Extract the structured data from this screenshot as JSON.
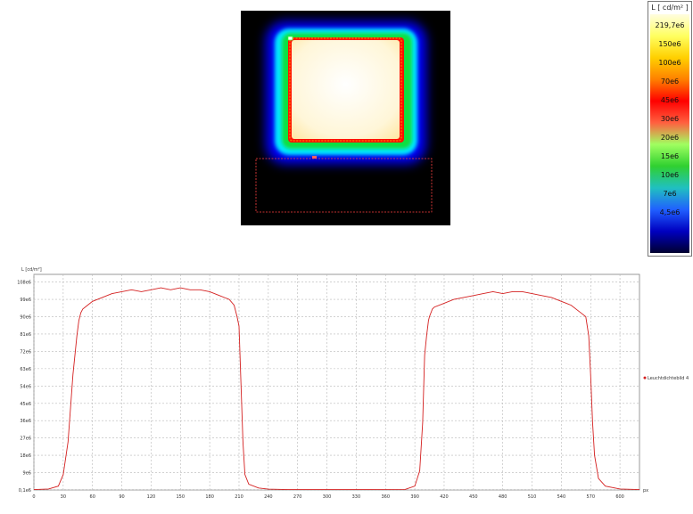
{
  "colorbar": {
    "title": "L [ cd/m² ]",
    "ticks": [
      {
        "label": "219,7e6",
        "value": 219.7
      },
      {
        "label": "150e6",
        "value": 150
      },
      {
        "label": "100e6",
        "value": 100
      },
      {
        "label": "70e6",
        "value": 70
      },
      {
        "label": "45e6",
        "value": 45
      },
      {
        "label": "30e6",
        "value": 30
      },
      {
        "label": "20e6",
        "value": 20
      },
      {
        "label": "15e6",
        "value": 15
      },
      {
        "label": "10e6",
        "value": 10
      },
      {
        "label": "7e6",
        "value": 7
      },
      {
        "label": "4,5e6",
        "value": 4.5
      }
    ],
    "colors": [
      "#fffde0",
      "#ffff60",
      "#ffd000",
      "#ff8000",
      "#ff0000",
      "#ff6040",
      "#a0ff60",
      "#30d030",
      "#20c0c0",
      "#2060ff",
      "#0000c0",
      "#000030"
    ]
  },
  "heatmap": {
    "type": "heatmap",
    "background": "#000000",
    "core_color": "#fffbe6",
    "glow_colors": [
      "#0000ff",
      "#00ffff",
      "#00ff00",
      "#ff0000"
    ],
    "roi_color": "#ff4040"
  },
  "chart_data": {
    "type": "line",
    "ylabel": "L [cd/m²]",
    "ytick_labels": [
      "0,1e6",
      "9e6",
      "18e6",
      "27e6",
      "36e6",
      "45e6",
      "54e6",
      "63e6",
      "72e6",
      "81e6",
      "90e6",
      "99e6",
      "108e6"
    ],
    "ytick_values": [
      0.1,
      9,
      18,
      27,
      36,
      45,
      54,
      63,
      72,
      81,
      90,
      99,
      108
    ],
    "xtick_labels": [
      "0",
      "30",
      "60",
      "90",
      "120",
      "150",
      "180",
      "210",
      "240",
      "270",
      "300",
      "330",
      "360",
      "390",
      "420",
      "450",
      "480",
      "510",
      "540",
      "570",
      "600"
    ],
    "xtick_values": [
      0,
      30,
      60,
      90,
      120,
      150,
      180,
      210,
      240,
      270,
      300,
      330,
      360,
      390,
      420,
      450,
      480,
      510,
      540,
      570,
      600
    ],
    "xunit": "px",
    "xlim": [
      0,
      620
    ],
    "ylim": [
      0,
      112
    ],
    "grid": true,
    "legend_position": "right",
    "series": [
      {
        "name": "Leuchtdichtebild 4",
        "color": "#d42020",
        "x": [
          0,
          15,
          25,
          30,
          35,
          40,
          42,
          44,
          46,
          48,
          50,
          55,
          60,
          70,
          80,
          90,
          100,
          110,
          120,
          130,
          140,
          150,
          160,
          170,
          180,
          190,
          200,
          205,
          208,
          210,
          212,
          214,
          216,
          220,
          230,
          240,
          260,
          300,
          340,
          380,
          390,
          395,
          398,
          400,
          402,
          404,
          405,
          408,
          410,
          420,
          430,
          440,
          450,
          460,
          470,
          480,
          490,
          500,
          510,
          520,
          530,
          540,
          550,
          560,
          565,
          568,
          570,
          572,
          574,
          578,
          585,
          600,
          620
        ],
        "y": [
          0.2,
          0.5,
          2,
          8,
          25,
          60,
          70,
          80,
          88,
          92,
          94,
          96,
          98,
          100,
          102,
          103,
          104,
          103,
          104,
          105,
          104,
          105,
          104,
          104,
          103,
          101,
          99,
          96,
          90,
          85,
          55,
          25,
          8,
          3,
          1,
          0.4,
          0.2,
          0.2,
          0.2,
          0.3,
          2,
          10,
          35,
          70,
          80,
          88,
          90,
          94,
          95,
          97,
          99,
          100,
          101,
          102,
          103,
          102,
          103,
          103,
          102,
          101,
          100,
          98,
          96,
          92,
          90,
          80,
          60,
          35,
          18,
          6,
          2,
          0.5,
          0.2
        ]
      }
    ]
  }
}
